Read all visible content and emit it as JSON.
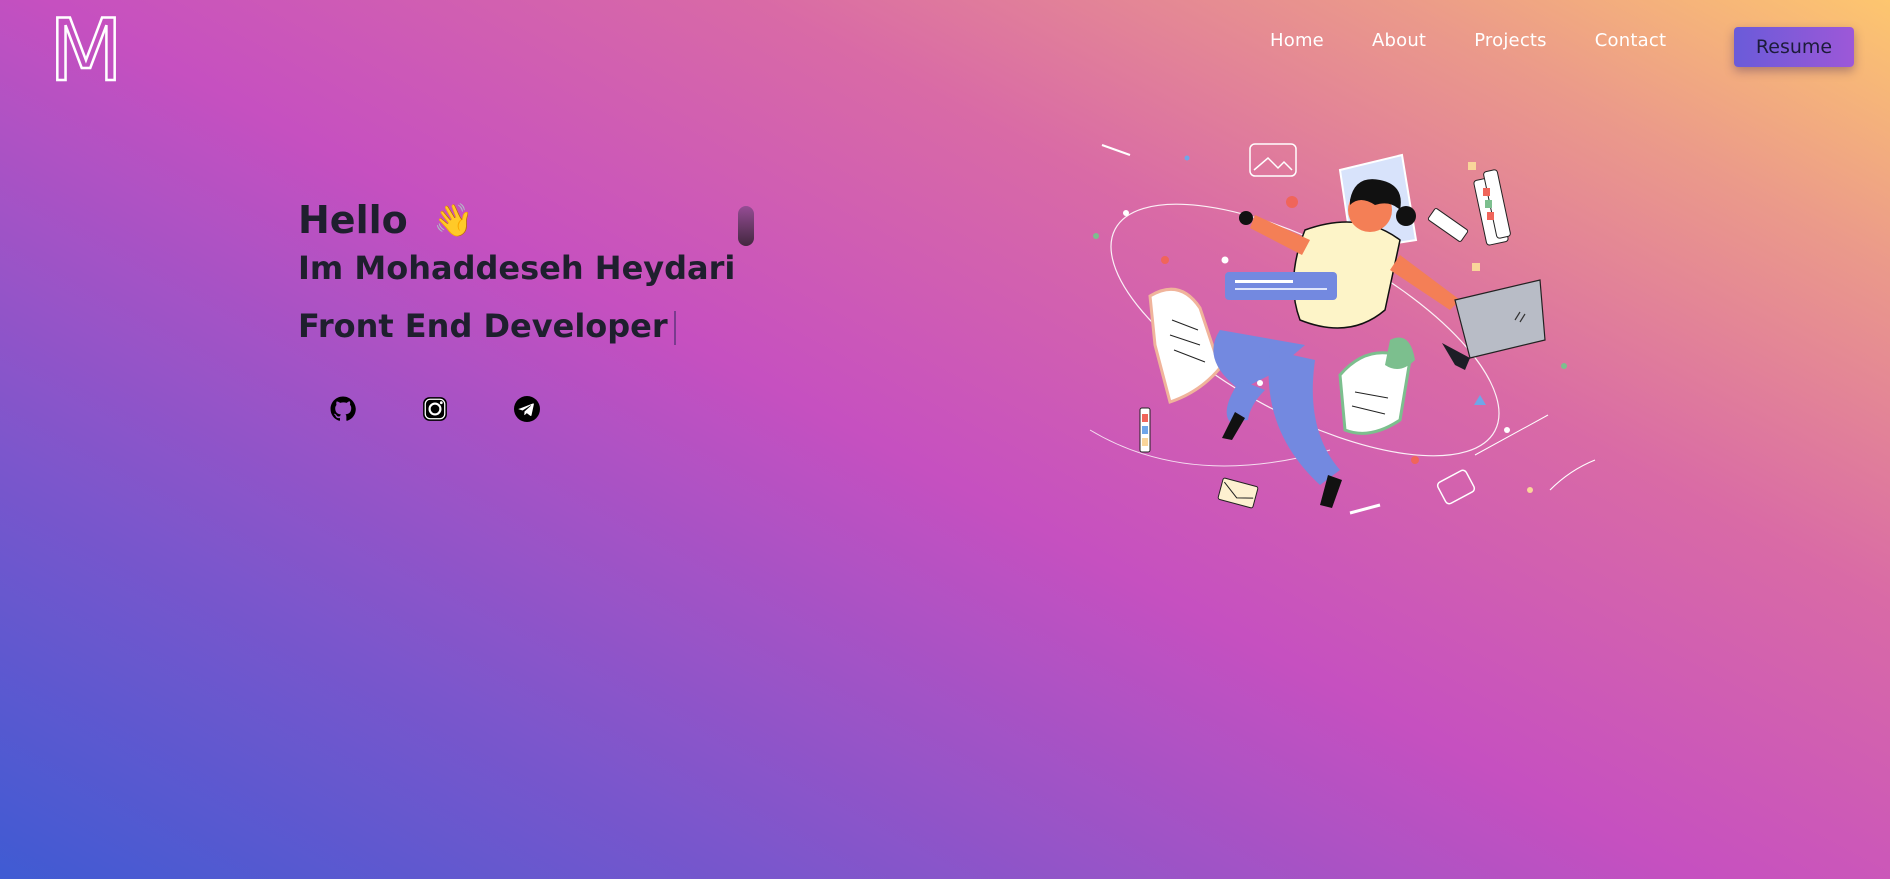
{
  "header": {
    "logo_letter": "M",
    "nav": [
      "Home",
      "About",
      "Projects",
      "Contact"
    ],
    "resume_label": "Resume"
  },
  "hero": {
    "greeting": "Hello",
    "wave_emoji": "👋",
    "name_line": "Im Mohaddeseh Heydari",
    "role_line": "Front End Developer"
  },
  "socials": [
    {
      "icon": "github-icon"
    },
    {
      "icon": "instagram-icon"
    },
    {
      "icon": "telegram-icon"
    }
  ],
  "colors": {
    "gradient_start": "#3f5bd3",
    "gradient_mid": "#c650c0",
    "gradient_end": "#fdc66f",
    "text": "#1f1f2e",
    "button": "#7a5ad8"
  }
}
